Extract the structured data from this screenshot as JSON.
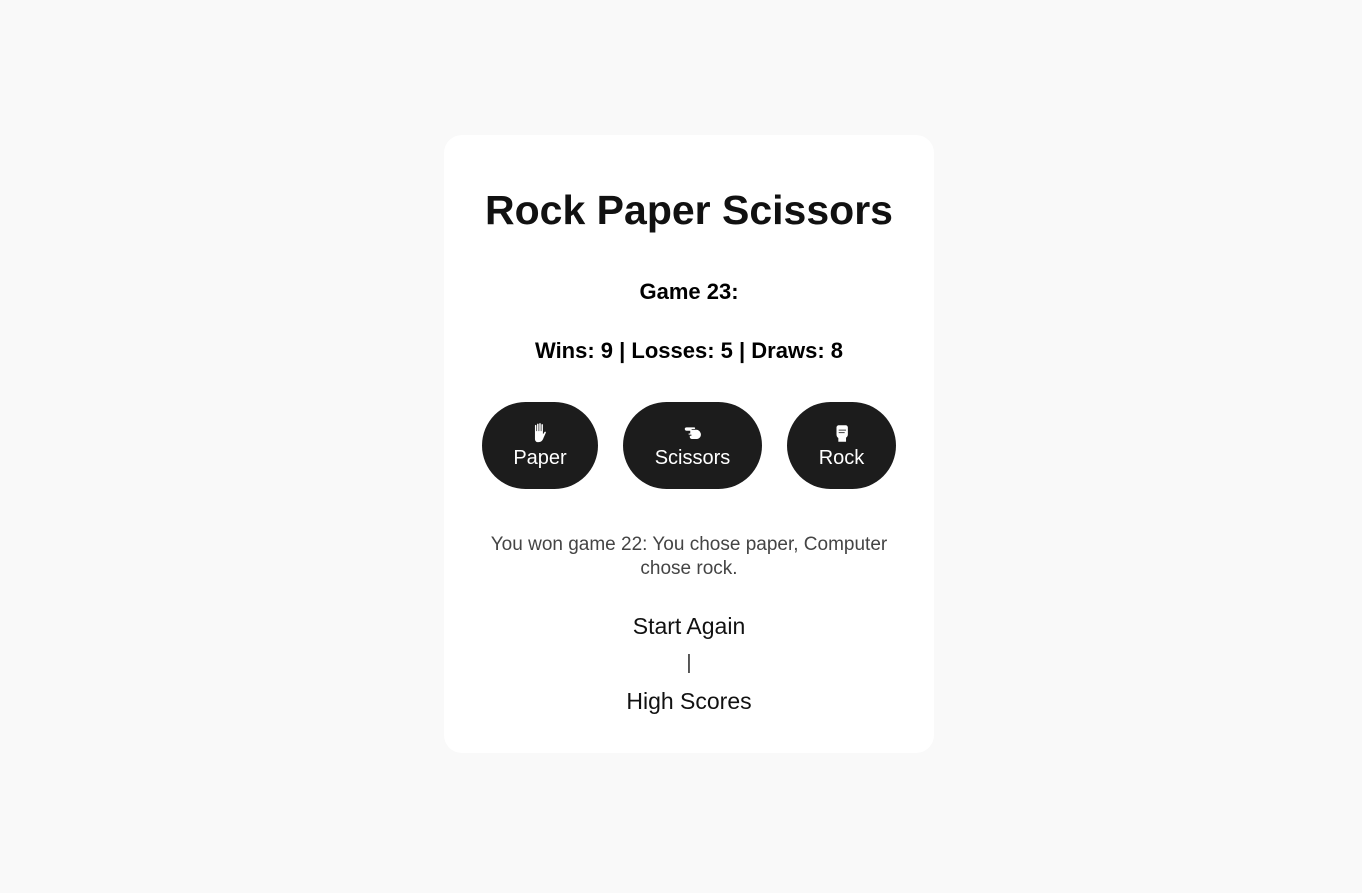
{
  "game": {
    "title": "Rock Paper Scissors",
    "game_number": "Game 23:",
    "score_line": "Wins: 9 | Losses: 5 | Draws: 8",
    "wins": 9,
    "losses": 5,
    "draws": 8
  },
  "choices": [
    {
      "label": "Paper",
      "icon": "raised-hand-icon"
    },
    {
      "label": "Scissors",
      "icon": "pointing-hand-icon"
    },
    {
      "label": "Rock",
      "icon": "fist-icon"
    }
  ],
  "result_text": "You won game 22: You chose paper, Computer chose rock.",
  "links": {
    "start_again": "Start Again",
    "separator": "|",
    "high_scores": "High Scores"
  },
  "colors": {
    "background": "#f9f9f9",
    "card": "#ffffff",
    "button": "#1c1c1c",
    "button_text": "#ffffff",
    "result_text": "#444444"
  }
}
